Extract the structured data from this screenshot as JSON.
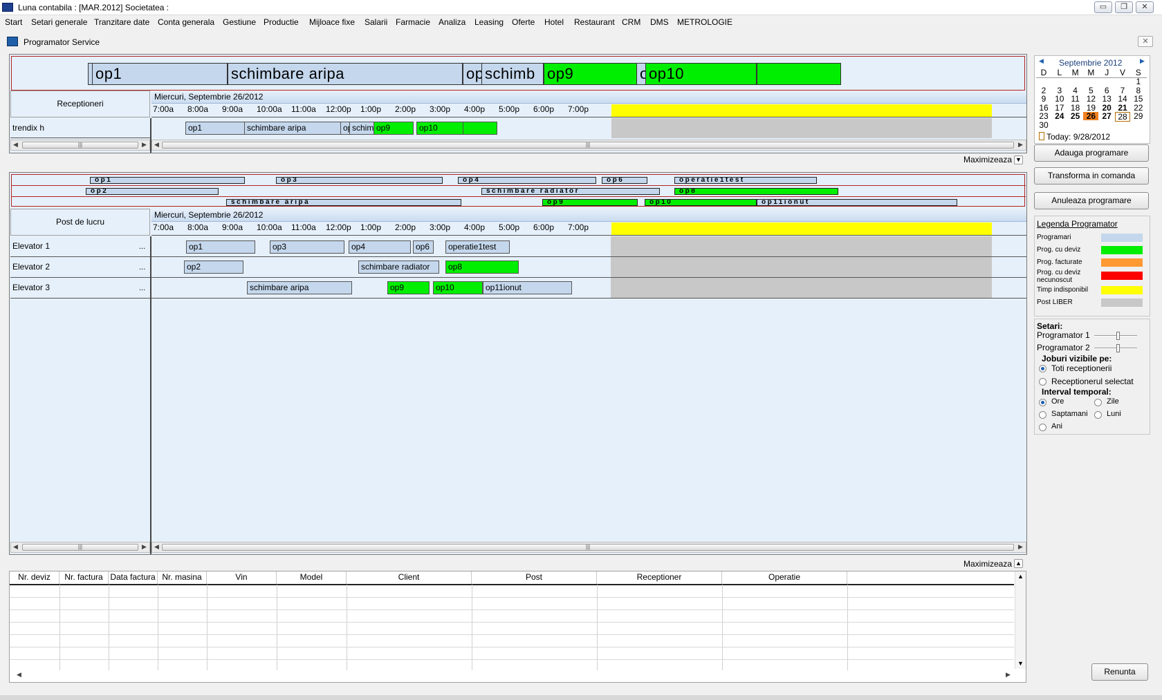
{
  "window": {
    "title": "Luna contabila : [MAR.2012]  Societatea :",
    "minimize": "▭",
    "restore": "❐",
    "close": "✕"
  },
  "menu": [
    "Start",
    "Setari generale",
    "Tranzitare date",
    "Conta generala",
    "Gestiune",
    "Productie",
    "Mijloace fixe",
    "Salarii",
    "Farmacie",
    "Analiza",
    "Leasing",
    "Oferte",
    "Hotel",
    "Restaurant",
    "CRM",
    "DMS",
    "METROLOGIE"
  ],
  "child": {
    "title": "Programator Service",
    "close": "✕"
  },
  "top_scheduler": {
    "overview_bars": [
      "op1",
      "schimbare aripa",
      "op",
      "schimb",
      "op9",
      "o",
      "op10",
      ""
    ],
    "header_label": "Receptioneri",
    "date": "Miercuri, Septembrie 26/2012",
    "hours": [
      "7:00a",
      "8:00a",
      "9:00a",
      "10:00a",
      "11:00a",
      "12:00p",
      "1:00p",
      "2:00p",
      "3:00p",
      "4:00p",
      "5:00p",
      "6:00p",
      "7:00p"
    ],
    "rows": [
      {
        "label": "trendix h",
        "events": [
          "op1",
          "schimbare aripa",
          "op",
          "schimb",
          "op9",
          "op10",
          ""
        ]
      }
    ],
    "maximize_label": "Maximizeaza"
  },
  "bottom_scheduler": {
    "overview_rows": [
      [
        "op1",
        "op3",
        "op4",
        "op6",
        "operatie1test"
      ],
      [
        "op2",
        "schimbare radiator",
        "op8"
      ],
      [
        "schimbare aripa",
        "op9",
        "op10",
        "op11ionut"
      ]
    ],
    "header_label": "Post de lucru",
    "date": "Miercuri, Septembrie 26/2012",
    "rows": [
      {
        "label": "Elevator 1",
        "dots": "...",
        "events": [
          "op1",
          "op3",
          "op4",
          "op6",
          "operatie1test"
        ]
      },
      {
        "label": "Elevator 2",
        "dots": "...",
        "events": [
          "op2",
          "schimbare radiator",
          "op8"
        ]
      },
      {
        "label": "Elevator 3",
        "dots": "...",
        "events": [
          "schimbare aripa",
          "op9",
          "op10",
          "op11ionut"
        ]
      }
    ],
    "maximize_label": "Maximizeaza"
  },
  "calendar": {
    "month": "Septembrie 2012",
    "weekdays": [
      "D",
      "L",
      "M",
      "M",
      "J",
      "V",
      "S"
    ],
    "weeks": [
      [
        "",
        "",
        "",
        "",
        "",
        "",
        "1"
      ],
      [
        "2",
        "3",
        "4",
        "5",
        "6",
        "7",
        "8"
      ],
      [
        "9",
        "10",
        "11",
        "12",
        "13",
        "14",
        "15"
      ],
      [
        "16",
        "17",
        "18",
        "19",
        "20",
        "21",
        "22"
      ],
      [
        "23",
        "24",
        "25",
        "26",
        "27",
        "28",
        "29"
      ],
      [
        "30",
        "",
        "",
        "",
        "",
        "",
        ""
      ]
    ],
    "today": "Today: 9/28/2012",
    "selected_day": "26",
    "today_day": "28"
  },
  "buttons": {
    "add": "Adauga programare",
    "transform": "Transforma in comanda",
    "cancel": "Anuleaza programare",
    "close": "Renunta"
  },
  "legend": {
    "title": "Legenda Programator",
    "items": [
      {
        "label": "Programari",
        "color": "#c4d7ec"
      },
      {
        "label": "Prog. cu deviz",
        "color": "#00ee00"
      },
      {
        "label": "Prog. facturate",
        "color": "#ff9933"
      },
      {
        "label": "Prog. cu deviz necunoscut",
        "color": "#ff0000"
      },
      {
        "label": "Timp indisponibil",
        "color": "#ffff00"
      },
      {
        "label": "Post LIBER",
        "color": "#c8c8c8"
      }
    ]
  },
  "settings": {
    "title": "Setari:",
    "slider1": "Programator 1",
    "slider2": "Programator 2",
    "jobs_title": "Joburi vizibile pe:",
    "jobs_all": "Toti receptionerii",
    "jobs_selected": "Receptionerul selectat",
    "interval_title": "Interval temporal:",
    "ore": "Ore",
    "zile": "Zile",
    "saptamani": "Saptamani",
    "luni": "Luni",
    "ani": "Ani"
  },
  "table": {
    "columns": [
      "Nr. deviz",
      "Nr. factura",
      "Data factura",
      "Nr. masina",
      "Vin",
      "Model",
      "Client",
      "Post",
      "Receptioner",
      "Operatie"
    ]
  }
}
